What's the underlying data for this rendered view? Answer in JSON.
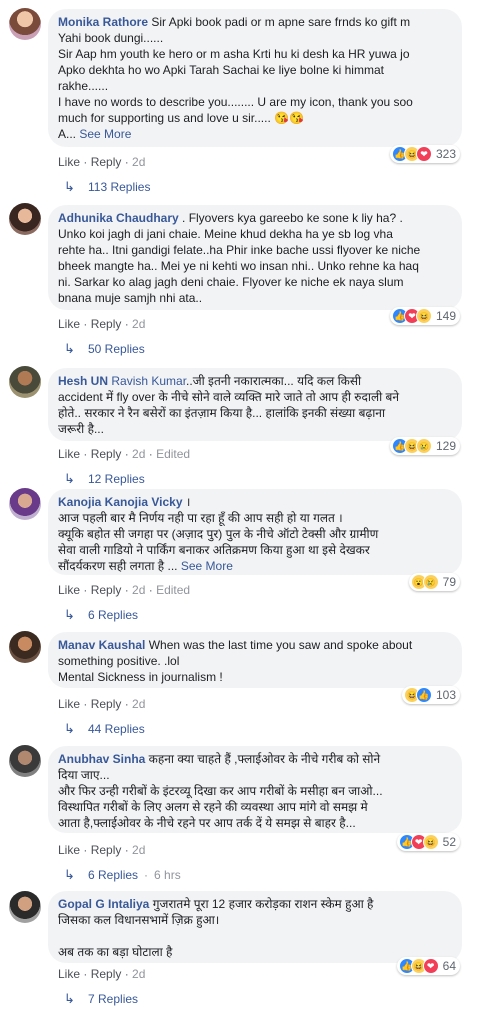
{
  "comments": [
    {
      "author": "Monika Rathore",
      "text_lines": [
        " Sir Apki book padi or m apne sare frnds ko gift m",
        "Yahi book dungi......",
        "Sir Aap hm youth ke hero or m asha Krti hu ki desh ka HR yuwa jo",
        "Apko dekhta ho wo Apki Tarah Sachai ke liye bolne ki himmat",
        "rakhe......",
        "I have no words to describe you........ U are my icon, thank you soo",
        "much for supporting us and love u sir..... 😘😘"
      ],
      "truncated_prefix": "A... ",
      "see_more": "See More",
      "like": "Like",
      "reply": "Reply",
      "time": "2d",
      "edited": "",
      "reaction_count": "323",
      "reaction_icons": [
        "like-reaction-icon",
        "haha-reaction-icon",
        "love-reaction-icon"
      ],
      "replies": "113 Replies",
      "replies_time": ""
    },
    {
      "author": "Adhunika Chaudhary",
      "text_lines": [
        " . Flyovers kya gareebo ke sone k liy ha? .",
        "Unko koi jagh di jani chaie. Meine khud dekha ha ye sb log vha",
        "rehte ha.. Itni gandigi felate..ha Phir inke bache ussi flyover ke niche",
        "bheek mangte ha.. Mei ye ni kehti wo insan nhi.. Unko rehne ka haq",
        "ni. Sarkar ko alag jagh deni chaie. Flyover ke niche ek naya slum",
        "bnana muje samjh nhi ata.."
      ],
      "truncated_prefix": "",
      "see_more": "",
      "like": "Like",
      "reply": "Reply",
      "time": "2d",
      "edited": "",
      "reaction_count": "149",
      "reaction_icons": [
        "like-reaction-icon",
        "love-reaction-icon",
        "haha-reaction-icon"
      ],
      "replies": "50 Replies",
      "replies_time": ""
    },
    {
      "author": "Hesh UN",
      "tag": " Ravish Kumar",
      "text_lines": [
        "..जी इतनी नकारात्मका... यदि कल किसी",
        "accident में fly over के नीचे सोने वाले व्यक्ति मारे जाते तो आप ही रुदाली बने",
        "होते.. सरकार ने रैन बसेरों का इंतज़ाम किया है... हालांकि इनकी संख्या बढ़ाना",
        "जरूरी है..."
      ],
      "truncated_prefix": "",
      "see_more": "",
      "like": "Like",
      "reply": "Reply",
      "time": "2d",
      "edited": "Edited",
      "reaction_count": "129",
      "reaction_icons": [
        "like-reaction-icon",
        "haha-reaction-icon",
        "sad-reaction-icon"
      ],
      "replies": "12 Replies",
      "replies_time": ""
    },
    {
      "author": "Kanojia Kanojia Vicky",
      "text_lines": [
        " ।",
        "आज पहली बार मै निर्णय नही पा रहा हूँ की आप सही हो या गलत ।",
        "क्यूकि बहोत सी जगहा पर (अज़ाद पुर) पुल के नीचे ऑटो टेक्सी और ग्रामीण",
        "सेवा वाली गाडियो ने पार्किंग बनाकर अतिक्रमण किया हुआ था इसे देखकर",
        "सौंदर्यकरण सही लगता है ... "
      ],
      "truncated_prefix": "",
      "see_more": "See More",
      "like": "Like",
      "reply": "Reply",
      "time": "2d",
      "edited": "Edited",
      "reaction_count": "79",
      "reaction_icons": [
        "wow-reaction-icon",
        "sad-reaction-icon"
      ],
      "replies": "6 Replies",
      "replies_time": ""
    },
    {
      "author": "Manav Kaushal",
      "text_lines": [
        " When was the last time you saw and spoke about",
        "something positive. .lol",
        "Mental Sickness in journalism !"
      ],
      "truncated_prefix": "",
      "see_more": "",
      "like": "Like",
      "reply": "Reply",
      "time": "2d",
      "edited": "",
      "reaction_count": "103",
      "reaction_icons": [
        "haha-reaction-icon",
        "like-reaction-icon"
      ],
      "replies": "44 Replies",
      "replies_time": ""
    },
    {
      "author": "Anubhav Sinha",
      "text_lines": [
        " कहना क्या चाहते हैं ,फ्लाईओवर के नीचे गरीब को सोने",
        "दिया जाए...",
        "और फिर उन्ही गरीबों के इंटरव्यू दिखा कर आप गरीबों के मसीहा बन जाओ...",
        "विस्थापित गरीबों के लिए अलग से रहने की व्यवस्था आप मांगे वो समझ मे",
        "आता है,फ्लाईओवर के नीचे रहने पर आप तर्क दें ये समझ से बाहर है..."
      ],
      "truncated_prefix": "",
      "see_more": "",
      "like": "Like",
      "reply": "Reply",
      "time": "2d",
      "edited": "",
      "reaction_count": "52",
      "reaction_icons": [
        "like-reaction-icon",
        "love-reaction-icon",
        "haha-reaction-icon"
      ],
      "replies": "6 Replies",
      "replies_time": "6 hrs"
    },
    {
      "author": "Gopal G Intaliya",
      "text_lines": [
        " गुजरातमे पूरा 12 हजार करोड़का राशन स्केम हुआ है",
        "जिसका कल विधानसभामें ज़िक्र हुआ।",
        "",
        "अब तक का बड़ा घोटाला है"
      ],
      "truncated_prefix": "",
      "see_more": "",
      "like": "Like",
      "reply": "Reply",
      "time": "2d",
      "edited": "",
      "reaction_count": "64",
      "reaction_icons": [
        "like-reaction-icon",
        "haha-reaction-icon",
        "love-reaction-icon"
      ],
      "replies": "7 Replies",
      "replies_time": ""
    }
  ],
  "separator": " · ",
  "colors": {
    "link": "#385898",
    "meta": "#90949c",
    "bubble": "#f2f3f5"
  }
}
